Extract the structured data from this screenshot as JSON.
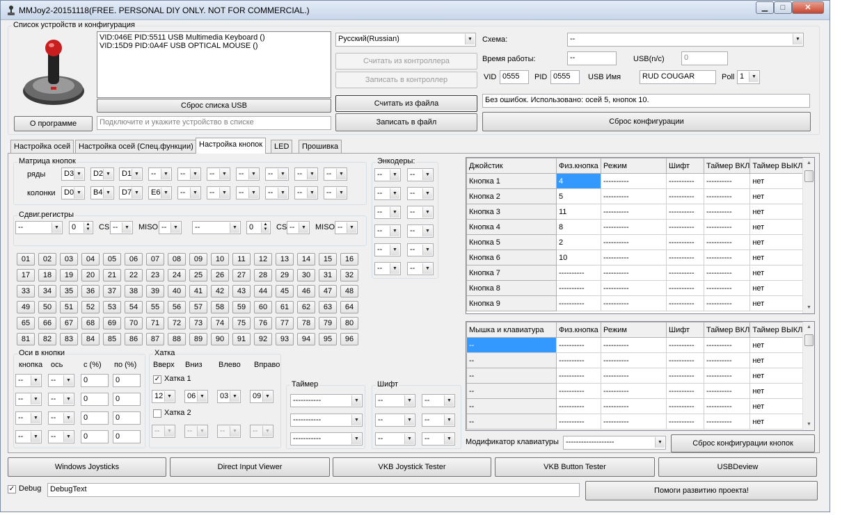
{
  "title": "MMJoy2-20151118(FREE. PERSONAL DIY ONLY. NOT FOR COMMERCIAL.)",
  "window_buttons": {
    "minimize": "▁",
    "maximize": "□",
    "close": "✕"
  },
  "devices": {
    "group_title": "Список устройств и конфигурация",
    "list": [
      "VID:046E PID:5511 USB Multimedia Keyboard ()",
      "VID:15D9 PID:0A4F  USB OPTICAL MOUSE ()"
    ],
    "reset_usb": "Сброс списка USB",
    "about": "О программе",
    "status_placeholder": "Подключите и укажите устройство в списке"
  },
  "lang": {
    "value": "Русский(Russian)"
  },
  "actions": {
    "read_ctrl": "Считать из контроллера",
    "write_ctrl": "Записать в контроллер",
    "read_file": "Считать из файла",
    "write_file": "Записать в файл",
    "reset_cfg": "Сброс конфигурации"
  },
  "config": {
    "scheme_label": "Схема:",
    "scheme_value": "--",
    "uptime_label": "Время работы:",
    "uptime_value": "--",
    "usb_label": "USB(n/c)",
    "usb_value": "0",
    "vid_label": "VID",
    "vid_value": "0555",
    "pid_label": "PID",
    "pid_value": "0555",
    "usbname_label": "USB Имя",
    "usbname_value": "RUD COUGAR",
    "poll_label": "Poll",
    "poll_value": "1",
    "status": "Без ошибок. Использовано: осей  5, кнопок  10."
  },
  "tabs": [
    "Настройка осей",
    "Настройка осей (Спец.функции)",
    "Настройка кнопок",
    "LED",
    "Прошивка"
  ],
  "matrix": {
    "title": "Матрица кнопок",
    "rows_label": "ряды",
    "cols_label": "колонки",
    "rows": [
      "D3",
      "D2",
      "D1",
      "--",
      "--",
      "--",
      "--",
      "--",
      "--",
      "--"
    ],
    "cols": [
      "D0",
      "B4",
      "D7",
      "E6",
      "--",
      "--",
      "--",
      "--",
      "--",
      "--"
    ]
  },
  "shift_regs": {
    "title": "Сдвиг.регистры",
    "combo1": "--",
    "spin1": "0",
    "cs_label": "CS",
    "cs1": "--",
    "miso_label": "MISO",
    "miso1": "--",
    "combo2": "--",
    "spin2": "0",
    "cs2": "--",
    "miso2": "--"
  },
  "button_numbers": [
    "01",
    "02",
    "03",
    "04",
    "05",
    "06",
    "07",
    "08",
    "09",
    "10",
    "11",
    "12",
    "13",
    "14",
    "15",
    "16",
    "17",
    "18",
    "19",
    "20",
    "21",
    "22",
    "23",
    "24",
    "25",
    "26",
    "27",
    "28",
    "29",
    "30",
    "31",
    "32",
    "33",
    "34",
    "35",
    "36",
    "37",
    "38",
    "39",
    "40",
    "41",
    "42",
    "43",
    "44",
    "45",
    "46",
    "47",
    "48",
    "49",
    "50",
    "51",
    "52",
    "53",
    "54",
    "55",
    "56",
    "57",
    "58",
    "59",
    "60",
    "61",
    "62",
    "63",
    "64",
    "65",
    "66",
    "67",
    "68",
    "69",
    "70",
    "71",
    "72",
    "73",
    "74",
    "75",
    "76",
    "77",
    "78",
    "79",
    "80",
    "81",
    "82",
    "83",
    "84",
    "85",
    "86",
    "87",
    "88",
    "89",
    "90",
    "91",
    "92",
    "93",
    "94",
    "95",
    "96"
  ],
  "encoders": {
    "title": "Энкодеры:",
    "value": "--"
  },
  "axes_btn": {
    "title": "Оси в кнопки",
    "h_btn": "кнопка",
    "h_axis": "ось",
    "h_from": "с (%)",
    "h_to": "по (%)",
    "combo": "--",
    "from": "0",
    "to": "0"
  },
  "hat": {
    "title": "Хатка",
    "h_up": "Вверх",
    "h_down": "Вниз",
    "h_left": "Влево",
    "h_right": "Вправо",
    "hat1": "Хатка 1",
    "hat2": "Хатка 2",
    "hat1_vals": [
      "12",
      "06",
      "03",
      "09"
    ],
    "hat2_vals": [
      "--",
      "--",
      "--",
      "--"
    ],
    "check": "✓"
  },
  "timer": {
    "title": "Таймер",
    "value": "-----------"
  },
  "shift": {
    "title": "Шифт",
    "value": "--"
  },
  "joy_grid": {
    "headers": [
      "Джойстик",
      "Физ.кнопка",
      "Режим",
      "Шифт",
      "Таймер ВКЛ",
      "Таймер ВЫКЛ"
    ],
    "rows": [
      [
        "Кнопка 1",
        "4",
        "----------",
        "----------",
        "----------",
        "нет"
      ],
      [
        "Кнопка 2",
        "5",
        "----------",
        "----------",
        "----------",
        "нет"
      ],
      [
        "Кнопка 3",
        "11",
        "----------",
        "----------",
        "----------",
        "нет"
      ],
      [
        "Кнопка 4",
        "8",
        "----------",
        "----------",
        "----------",
        "нет"
      ],
      [
        "Кнопка 5",
        "2",
        "----------",
        "----------",
        "----------",
        "нет"
      ],
      [
        "Кнопка 6",
        "10",
        "----------",
        "----------",
        "----------",
        "нет"
      ],
      [
        "Кнопка 7",
        "----------",
        "----------",
        "----------",
        "----------",
        "нет"
      ],
      [
        "Кнопка 8",
        "----------",
        "----------",
        "----------",
        "----------",
        "нет"
      ],
      [
        "Кнопка 9",
        "----------",
        "----------",
        "----------",
        "----------",
        "нет"
      ]
    ]
  },
  "kb_grid": {
    "headers": [
      "Мышка и клавиатура",
      "Физ.кнопка",
      "Режим",
      "Шифт",
      "Таймер ВКЛ",
      "Таймер ВЫКЛ"
    ],
    "rows": [
      [
        "--",
        "----------",
        "----------",
        "----------",
        "----------",
        "нет"
      ],
      [
        "--",
        "----------",
        "----------",
        "----------",
        "----------",
        "нет"
      ],
      [
        "--",
        "----------",
        "----------",
        "----------",
        "----------",
        "нет"
      ],
      [
        "--",
        "----------",
        "----------",
        "----------",
        "----------",
        "нет"
      ],
      [
        "--",
        "----------",
        "----------",
        "----------",
        "----------",
        "нет"
      ],
      [
        "--",
        "----------",
        "----------",
        "----------",
        "----------",
        "нет"
      ]
    ]
  },
  "modifier": {
    "label": "Модификатор клавиатуры",
    "value": "-------------------",
    "reset_btn": "Сброс конфигурации кнопок"
  },
  "tools": [
    "Windows Joysticks",
    "Direct Input Viewer",
    "VKB Joystick Tester",
    "VKB Button Tester",
    "USBDeview"
  ],
  "debug": {
    "label": "Debug",
    "check": "✓",
    "text": "DebugText",
    "support": "Помоги развитию проекта!"
  },
  "icons": {
    "app": "joystick-icon",
    "arrow": "▼",
    "up": "▲",
    "down": "▼"
  }
}
